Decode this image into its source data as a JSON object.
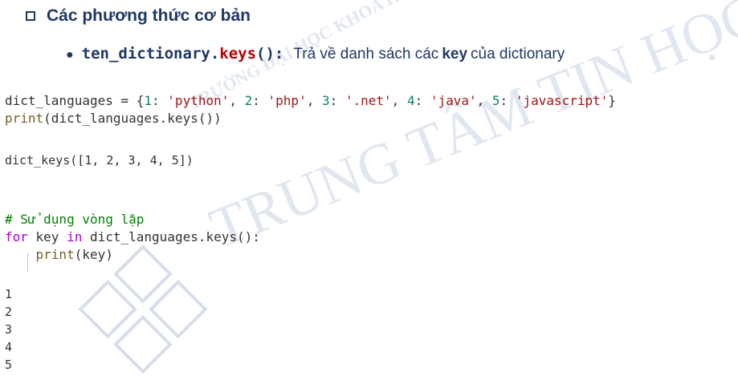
{
  "heading": {
    "title": "Các phương thức cơ bản"
  },
  "bullet": {
    "func_prefix": "ten_dictionary.",
    "func_name": "keys",
    "func_suffix": "():",
    "desc_before": "Trả về danh sách các",
    "desc_keyword": "key",
    "desc_after": "của dictionary"
  },
  "code1": {
    "var": "dict_languages",
    "eq": " = {",
    "k1": "1",
    "v1": "'python'",
    "k2": "2",
    "v2": "'php'",
    "k3": "3",
    "v3": "'.net'",
    "k4": "4",
    "v4": "'java'",
    "k5": "5",
    "v5": "'javascript'",
    "close": "}",
    "print_fn": "print",
    "print_arg": "(dict_languages.keys())"
  },
  "output1": "dict_keys([1, 2, 3, 4, 5])",
  "code2": {
    "comment": "# Sử dụng vòng lặp",
    "for_kw": "for",
    "loop_mid": " key ",
    "in_kw": "in",
    "loop_rest": " dict_languages.keys():",
    "print_fn": "print",
    "print_arg": "(key)"
  },
  "output2": [
    "1",
    "2",
    "3",
    "4",
    "5"
  ],
  "watermark": {
    "line1": "TRƯỜNG ĐẠI HỌC KHOA HỌC TỰ NHIÊN",
    "line2": "TRUNG TÂM TIN HỌC"
  }
}
